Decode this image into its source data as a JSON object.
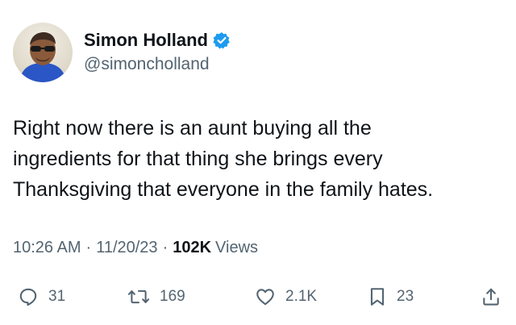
{
  "author": {
    "display_name": "Simon Holland",
    "handle": "@simoncholland",
    "verified": true
  },
  "tweet": {
    "text": "Right now there is an aunt buying all the\ningredients for that thing she brings every\nThanksgiving that everyone in the family hates."
  },
  "meta": {
    "time": "10:26 AM",
    "separator": "·",
    "date": "11/20/23",
    "views_count": "102K",
    "views_label": "Views"
  },
  "actions": {
    "replies": "31",
    "retweets": "169",
    "likes": "2.1K",
    "bookmarks": "23"
  },
  "colors": {
    "text_primary": "#0f1419",
    "text_secondary": "#536471",
    "verified_blue": "#1d9bf0"
  },
  "icons": {
    "reply": "reply-icon",
    "retweet": "retweet-icon",
    "like": "heart-icon",
    "bookmark": "bookmark-icon",
    "share": "share-icon",
    "verified": "verified-badge-icon"
  }
}
